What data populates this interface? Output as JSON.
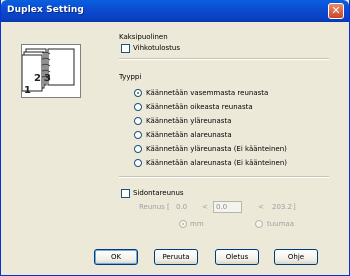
{
  "window": {
    "title": "Duplex Setting"
  },
  "duplex_section": {
    "heading": "Kaksipuolinen",
    "booklet_label": "Vihkotulostus"
  },
  "type_section": {
    "heading": "Tyyppi",
    "options": [
      "Käännetään vasemmasta reunasta",
      "Käännetään oikeasta reunasta",
      "Käännetään yläreunasta",
      "Käännetään alareunasta",
      "Käännetään yläreunasta (Ei käänteinen)",
      "Käännetään alareunasta (Ei käänteinen)"
    ],
    "selected_index": 0
  },
  "binding_offset": {
    "checkbox_label": "Sidontareunus",
    "field_label": "Reunus [",
    "min_value": "0.0",
    "lt1": "<",
    "value": "0.0",
    "lt2": "<",
    "max_value": "203.2",
    "close_bracket": "]",
    "unit_mm": "mm",
    "unit_inch": "tuumaa",
    "selected_unit": "mm"
  },
  "preview": {
    "page_left": "2",
    "page_right": "3",
    "page_bottom": "1"
  },
  "buttons": {
    "ok": "OK",
    "cancel": "Peruuta",
    "default": "Oletus",
    "help": "Ohje"
  }
}
